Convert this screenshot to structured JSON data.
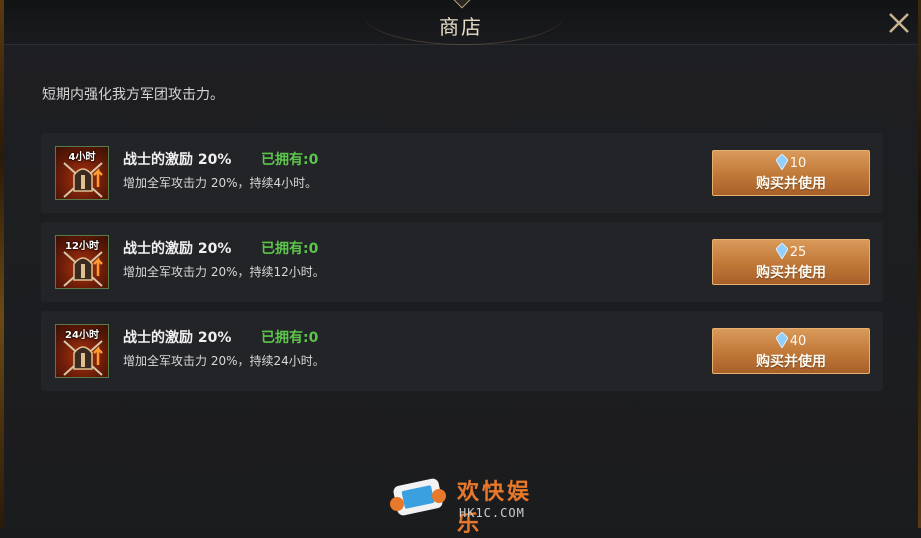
{
  "header": {
    "title": "商店"
  },
  "description": "短期内强化我方军团攻击力。",
  "items": [
    {
      "icon_label": "4小时",
      "name": "战士的激励 20%",
      "owned": "已拥有:0",
      "desc": "增加全军攻击力 20%，持续4小时。",
      "price": "10",
      "buy_label": "购买并使用"
    },
    {
      "icon_label": "12小时",
      "name": "战士的激励 20%",
      "owned": "已拥有:0",
      "desc": "增加全军攻击力 20%，持续12小时。",
      "price": "25",
      "buy_label": "购买并使用"
    },
    {
      "icon_label": "24小时",
      "name": "战士的激励 20%",
      "owned": "已拥有:0",
      "desc": "增加全军攻击力 20%，持续24小时。",
      "price": "40",
      "buy_label": "购买并使用"
    }
  ],
  "watermark": {
    "title": "欢快娱乐",
    "url": "HK1C.COM"
  },
  "icons": {
    "close": "close-icon",
    "currency": "crystal-gem-icon",
    "item": "warrior-helmet-icon",
    "logo": "game-controller-icon"
  },
  "colors": {
    "owned": "#5cc44a",
    "button": "#c07838",
    "watermark": "#e8782a"
  }
}
